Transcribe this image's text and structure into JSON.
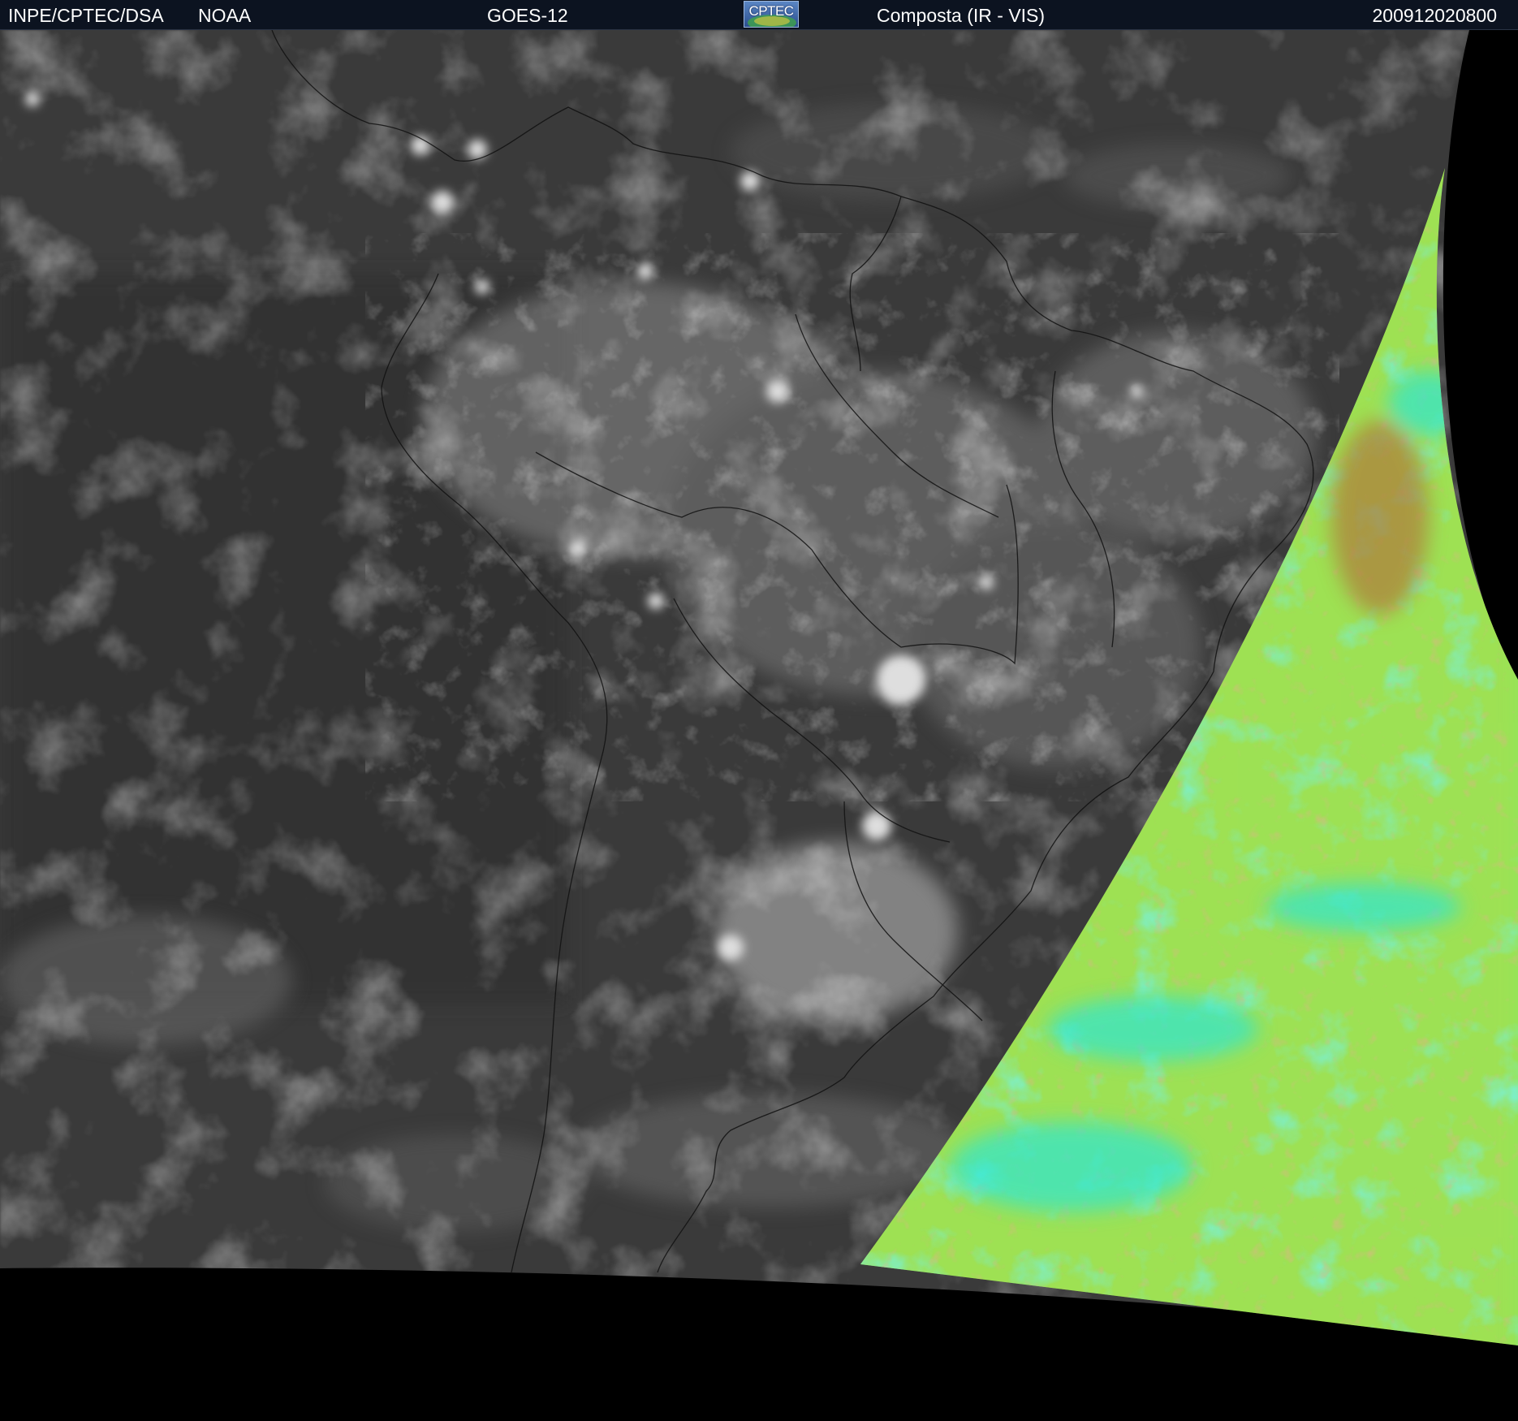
{
  "header": {
    "organization": "INPE/CPTEC/DSA",
    "agency": "NOAA",
    "satellite": "GOES-12",
    "logo_text": "CPTEC",
    "product": "Composta (IR - VIS)",
    "timestamp": "200912020800"
  },
  "imagery": {
    "ir_color": "#3a3a3a",
    "vis_color": "#8fe65a",
    "vis_accent_color": "#2ee6d2",
    "vis_warm_color": "#b07a3a",
    "space_color": "#000000"
  }
}
